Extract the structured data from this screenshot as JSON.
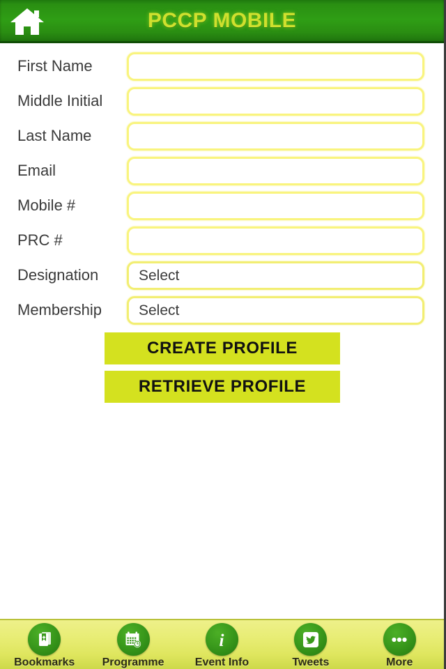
{
  "header": {
    "title": "PCCP MOBILE",
    "home_icon": "home-icon",
    "bg_color": "#2a8f12",
    "title_color": "#cfe02e"
  },
  "form": {
    "fields": [
      {
        "label": "First Name",
        "type": "text",
        "value": "",
        "placeholder": ""
      },
      {
        "label": "Middle Initial",
        "type": "text",
        "value": "",
        "placeholder": ""
      },
      {
        "label": "Last Name",
        "type": "text",
        "value": "",
        "placeholder": ""
      },
      {
        "label": "Email",
        "type": "text",
        "value": "",
        "placeholder": ""
      },
      {
        "label": "Mobile #",
        "type": "text",
        "value": "",
        "placeholder": ""
      },
      {
        "label": "PRC #",
        "type": "text",
        "value": "",
        "placeholder": ""
      },
      {
        "label": "Designation",
        "type": "select",
        "value": "Select",
        "placeholder": ""
      },
      {
        "label": "Membership",
        "type": "select",
        "value": "Select",
        "placeholder": ""
      }
    ],
    "field_border_color": "#f9f47e"
  },
  "actions": {
    "create_label": "CREATE PROFILE",
    "retrieve_label": "RETRIEVE PROFILE",
    "button_color": "#d4e11f"
  },
  "tabbar": {
    "tabs": [
      {
        "label": "Bookmarks",
        "icon": "bookmark-icon"
      },
      {
        "label": "Programme",
        "icon": "calendar-clock-icon"
      },
      {
        "label": "Event Info",
        "icon": "info-icon"
      },
      {
        "label": "Tweets",
        "icon": "twitter-bird-icon"
      },
      {
        "label": "More",
        "icon": "ellipsis-icon"
      }
    ],
    "bg_color": "#e8ed75",
    "icon_color": "#339215"
  }
}
